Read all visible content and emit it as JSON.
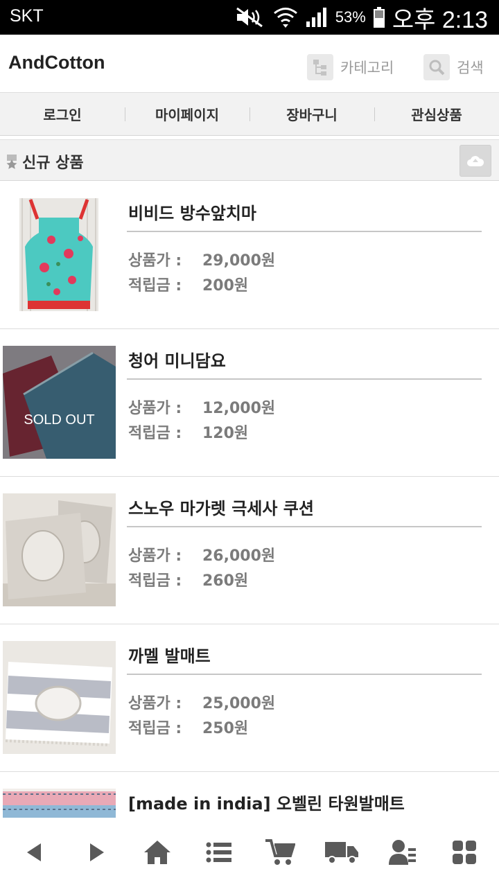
{
  "status_bar": {
    "carrier": "SKT",
    "battery": "53%",
    "time": "오후 2:13"
  },
  "header": {
    "brand": "AndCotton",
    "category_label": "카테고리",
    "search_label": "검색"
  },
  "nav": {
    "items": [
      "로그인",
      "마이페이지",
      "장바구니",
      "관심상품"
    ]
  },
  "section": {
    "title": "신규 상품"
  },
  "labels": {
    "price": "상품가 :",
    "points": "적립금 :"
  },
  "products": [
    {
      "name": "비비드 방수앞치마",
      "price": "29,000원",
      "points": "200원",
      "sold_out": ""
    },
    {
      "name": "청어 미니담요",
      "price": "12,000원",
      "points": "120원",
      "sold_out": "SOLD OUT"
    },
    {
      "name": "스노우 마가렛 극세사 쿠션",
      "price": "26,000원",
      "points": "260원",
      "sold_out": ""
    },
    {
      "name": "까멜 발매트",
      "price": "25,000원",
      "points": "250원",
      "sold_out": ""
    },
    {
      "name": "[made in india] 오벨린 타원발매트",
      "price": "",
      "points": "",
      "sold_out": ""
    }
  ],
  "bottom_bar": {
    "icons": [
      "back-icon",
      "forward-icon",
      "home-icon",
      "list-icon",
      "cart-icon",
      "delivery-truck-icon",
      "member-icon",
      "grid-menu-icon"
    ]
  },
  "colors": {
    "accent_gray": "#7b7b7b",
    "icon_gray": "#5a5a5a"
  }
}
